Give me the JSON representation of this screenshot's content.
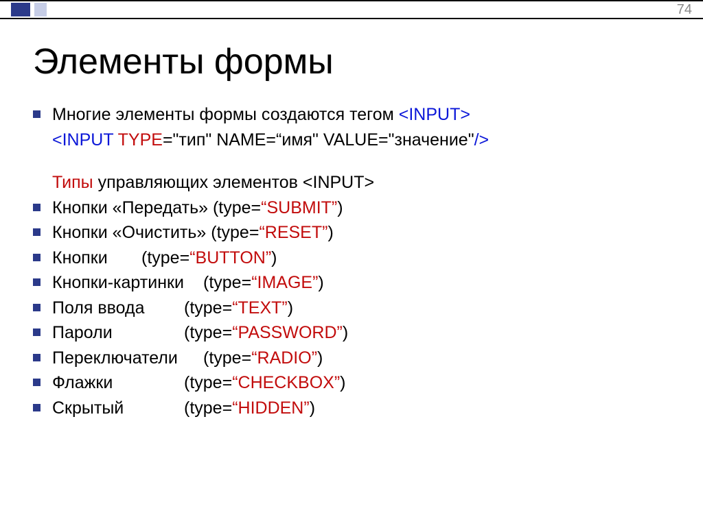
{
  "page_number": "74",
  "title": "Элементы формы",
  "intro": {
    "line1_pre": "Многие элементы формы создаются тегом ",
    "line1_tag": "<INPUT>",
    "line2_lt": "<",
    "line2_input": "INPUT ",
    "line2_type": "TYPE",
    "line2_type_val": "=\"тип\"  ",
    "line2_name": "NAME=“имя\" ",
    "line2_value": "VALUE=\"значение\"",
    "line2_close": "/>"
  },
  "section_label_pre": "Типы",
  "section_label_post": " управляющих элементов <INPUT>",
  "types": [
    {
      "label": "Кнопки «Передать» ",
      "attr": "(type=",
      "value": "“SUBMIT”",
      "close": ")"
    },
    {
      "label": "Кнопки «Очистить» ",
      "attr": "(type=",
      "value": "“RESET”",
      "close": ")"
    },
    {
      "label_tab": "Кнопки",
      "tabclass": "tab3",
      "attr": "(type=",
      "value": "“BUTTON”",
      "close": ")"
    },
    {
      "label_tab": "Кнопки-картинки",
      "tabclass": "tab1",
      "attr": "(type=",
      "value": "“IMAGE”",
      "close": ")"
    },
    {
      "label_tab": "Поля ввода",
      "tabclass": "tab2",
      "attr": "(type=",
      "value": "“TEXT”",
      "close": ")"
    },
    {
      "label_tab": "Пароли",
      "tabclass": "tab2",
      "attr": "(type=",
      "value": "“PASSWORD”",
      "close": ")"
    },
    {
      "label_tab": "Переключатели",
      "tabclass": "tab1",
      "attr": "(type=",
      "value": "“RADIO”",
      "close": ")"
    },
    {
      "label_tab": "Флажки",
      "tabclass": "tab2",
      "attr": "(type=",
      "value": "“CHECKBOX”",
      "close": ")"
    },
    {
      "label_tab": "Скрытый",
      "tabclass": "tab2",
      "attr": "(type=",
      "value": "“HIDDEN”",
      "close": ")"
    }
  ]
}
